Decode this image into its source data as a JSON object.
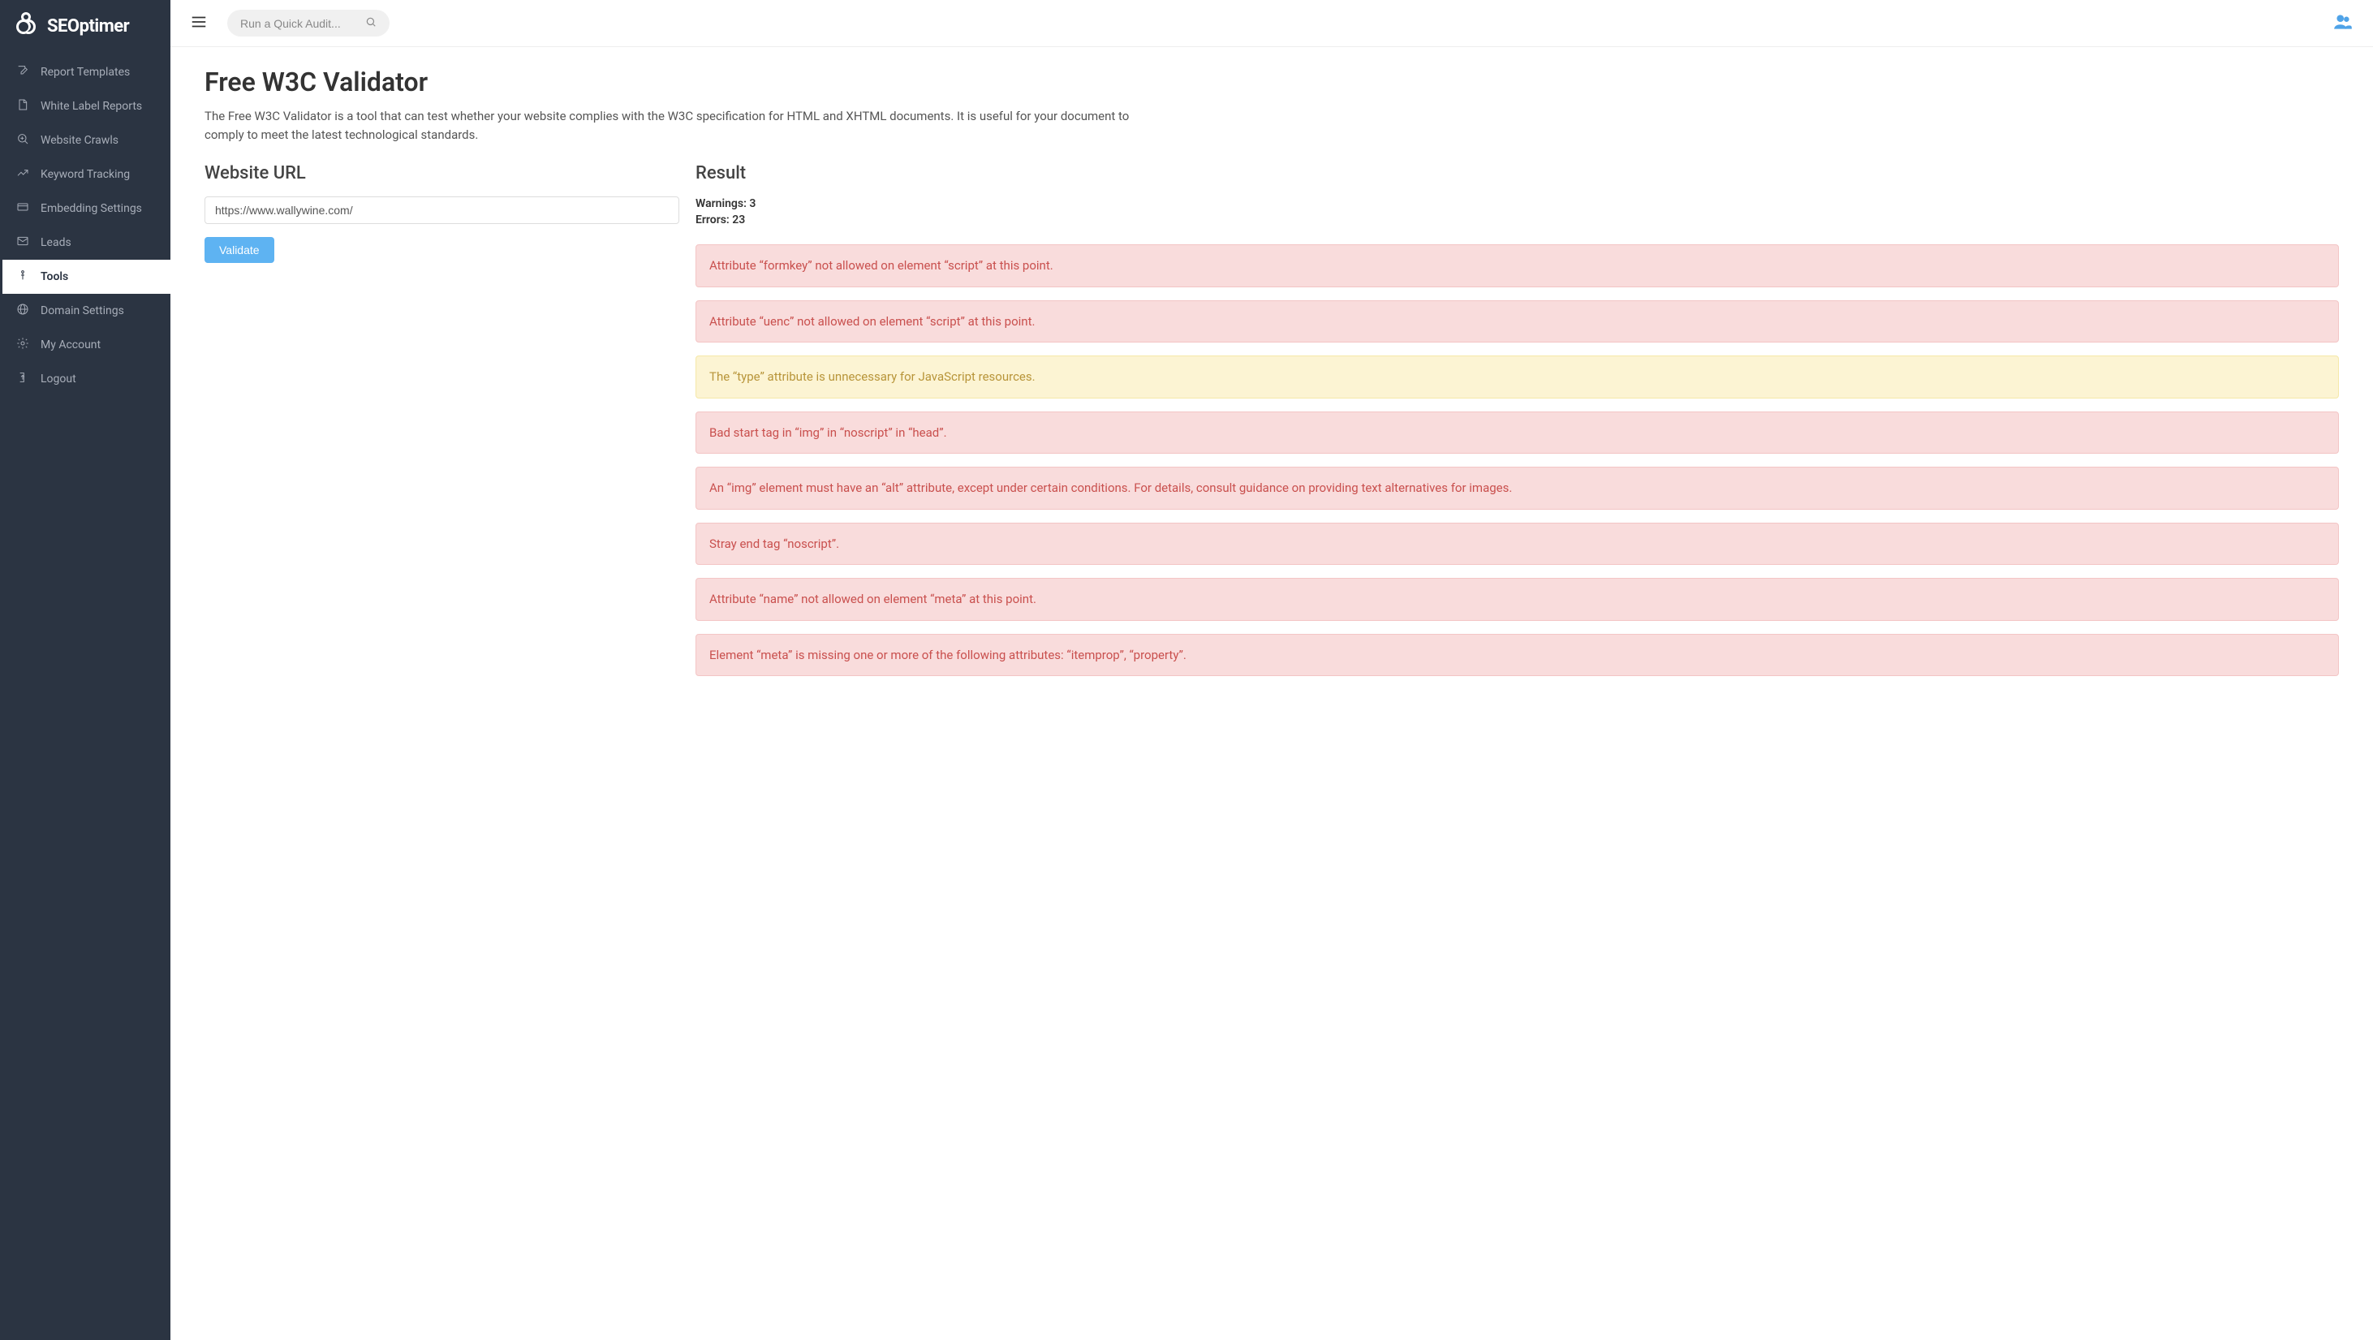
{
  "brand": {
    "name": "SEOptimer"
  },
  "topbar": {
    "search_placeholder": "Run a Quick Audit..."
  },
  "sidebar": {
    "items": [
      {
        "label": "Report Templates",
        "icon": "edit",
        "active": false
      },
      {
        "label": "White Label Reports",
        "icon": "file",
        "active": false
      },
      {
        "label": "Website Crawls",
        "icon": "zoom",
        "active": false
      },
      {
        "label": "Keyword Tracking",
        "icon": "trend",
        "active": false
      },
      {
        "label": "Embedding Settings",
        "icon": "embed",
        "active": false
      },
      {
        "label": "Leads",
        "icon": "mail",
        "active": false
      },
      {
        "label": "Tools",
        "icon": "tool",
        "active": true
      },
      {
        "label": "Domain Settings",
        "icon": "globe",
        "active": false
      },
      {
        "label": "My Account",
        "icon": "gear",
        "active": false
      },
      {
        "label": "Logout",
        "icon": "logout",
        "active": false
      }
    ]
  },
  "page": {
    "title": "Free W3C Validator",
    "description": "The Free W3C Validator is a tool that can test whether your website complies with the W3C specification for HTML and XHTML documents. It is useful for your document to comply to meet the latest technological standards."
  },
  "form": {
    "url_label": "Website URL",
    "url_value": "https://www.wallywine.com/",
    "submit_label": "Validate"
  },
  "result": {
    "header": "Result",
    "warnings_label": "Warnings: ",
    "warnings_count": "3",
    "errors_label": "Errors: ",
    "errors_count": "23",
    "items": [
      {
        "type": "error",
        "message": "Attribute “formkey” not allowed on element “script” at this point."
      },
      {
        "type": "error",
        "message": "Attribute “uenc” not allowed on element “script” at this point."
      },
      {
        "type": "warning",
        "message": "The “type” attribute is unnecessary for JavaScript resources."
      },
      {
        "type": "error",
        "message": "Bad start tag in “img” in “noscript” in “head”."
      },
      {
        "type": "error",
        "message": "An “img” element must have an “alt” attribute, except under certain conditions. For details, consult guidance on providing text alternatives for images."
      },
      {
        "type": "error",
        "message": "Stray end tag “noscript”."
      },
      {
        "type": "error",
        "message": "Attribute “name” not allowed on element “meta” at this point."
      },
      {
        "type": "error",
        "message": "Element “meta” is missing one or more of the following attributes: “itemprop”, “property”."
      }
    ]
  }
}
